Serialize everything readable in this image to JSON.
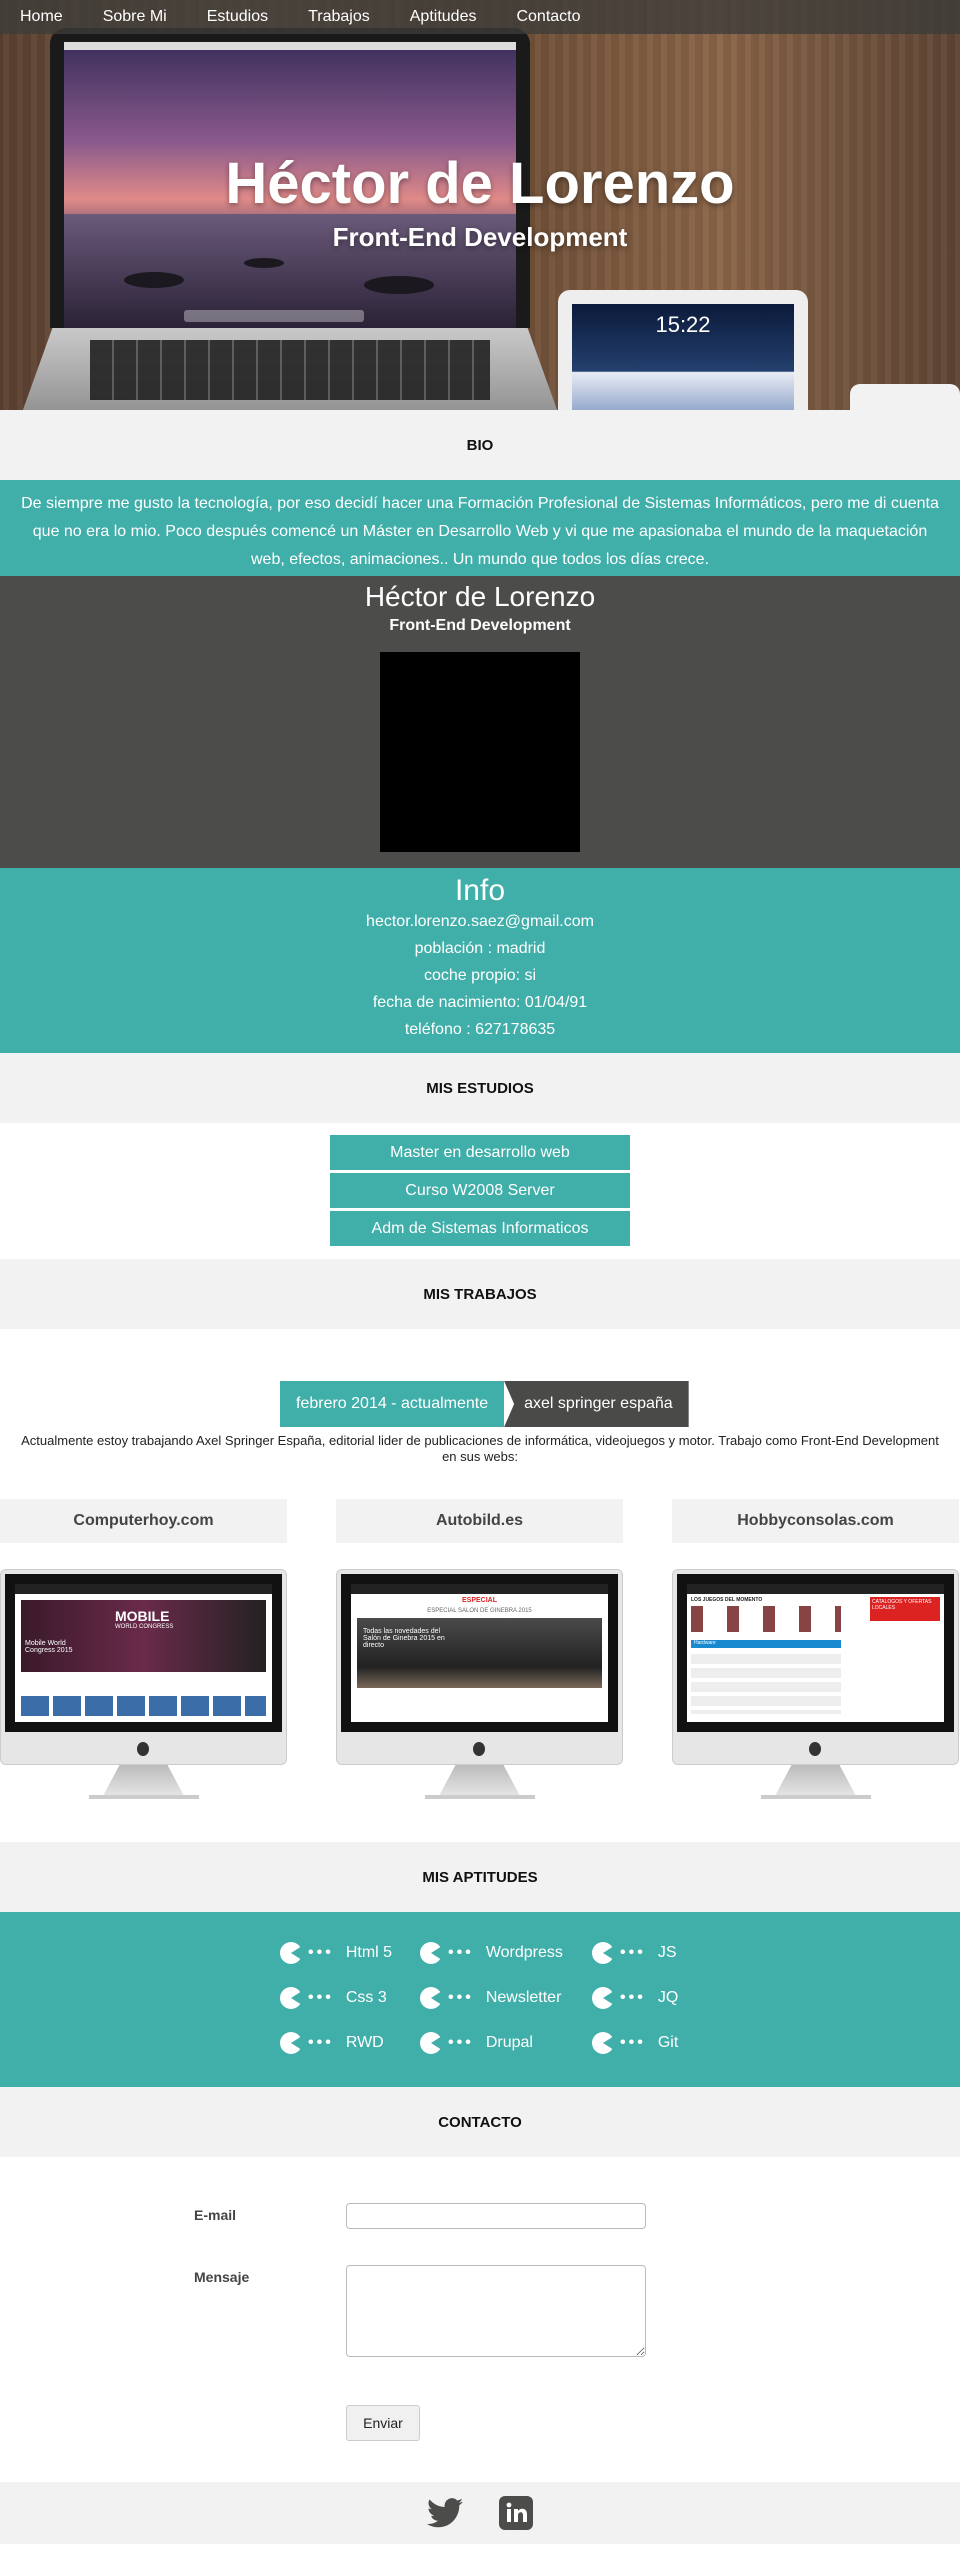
{
  "nav": [
    "Home",
    "Sobre Mi",
    "Estudios",
    "Trabajos",
    "Aptitudes",
    "Contacto"
  ],
  "hero": {
    "title": "Héctor de Lorenzo",
    "subtitle": "Front-End Development",
    "ipad_time": "15:22"
  },
  "bio": {
    "heading": "BIO",
    "text": "De siempre me gusto la tecnología, por eso decidí hacer una Formación Profesional de Sistemas Informáticos, pero me di cuenta que no era lo mio. Poco después comencé un Máster en Desarrollo Web y vi que me apasionaba el mundo de la maquetación web, efectos, animaciones.. Un mundo que todos los días crece."
  },
  "profile": {
    "name": "Héctor de Lorenzo",
    "role": "Front-End Development"
  },
  "info": {
    "title": "Info",
    "lines": [
      "hector.lorenzo.saez@gmail.com",
      "población : madrid",
      "coche propio: si",
      "fecha de nacimiento: 01/04/91",
      "teléfono : 627178635"
    ]
  },
  "estudios": {
    "heading": "MIS ESTUDIOS",
    "items": [
      "Master en desarrollo web",
      "Curso W2008 Server",
      "Adm de Sistemas Informaticos"
    ]
  },
  "trabajos": {
    "heading": "MIS TRABAJOS",
    "period": "febrero 2014 - actualmente",
    "company": "axel springer españa",
    "description": "Actualmente estoy trabajando Axel Springer España, editorial lider de publicaciones de informática, videojuegos y motor. Trabajo como Front-End Development en sus webs:",
    "sites": [
      {
        "name": "Computerhoy.com",
        "shot_title": "MOBILE",
        "shot_sub": "WORLD CONGRESS",
        "shot_caption": "Mobile World Congress 2015"
      },
      {
        "name": "Autobild.es",
        "shot_title": "ESPECIAL",
        "shot_sub": "ESPECIAL SALON DE GINEBRA 2015",
        "shot_caption": "Todas las novedades del Salón de Ginebra 2015 en directo"
      },
      {
        "name": "Hobbyconsolas.com",
        "shot_title": "LOS JUEGOS DEL MOMENTO",
        "shot_sub": "CATALOGOS Y OFERTAS LOCALES",
        "shot_caption": "Hardware"
      }
    ]
  },
  "aptitudes": {
    "heading": "MIS APTITUDES",
    "items": [
      "Html 5",
      "Wordpress",
      "JS",
      "Css 3",
      "Newsletter",
      "JQ",
      "RWD",
      "Drupal",
      "Git"
    ]
  },
  "contacto": {
    "heading": "CONTACTO",
    "email_label": "E-mail",
    "message_label": "Mensaje",
    "email_value": "",
    "message_value": "",
    "submit": "Enviar"
  },
  "footer": {
    "icons": [
      "twitter-icon",
      "linkedin-icon"
    ]
  },
  "colors": {
    "teal": "#40aea9",
    "dark": "#4c4c4a",
    "light": "#f2f2f2"
  }
}
